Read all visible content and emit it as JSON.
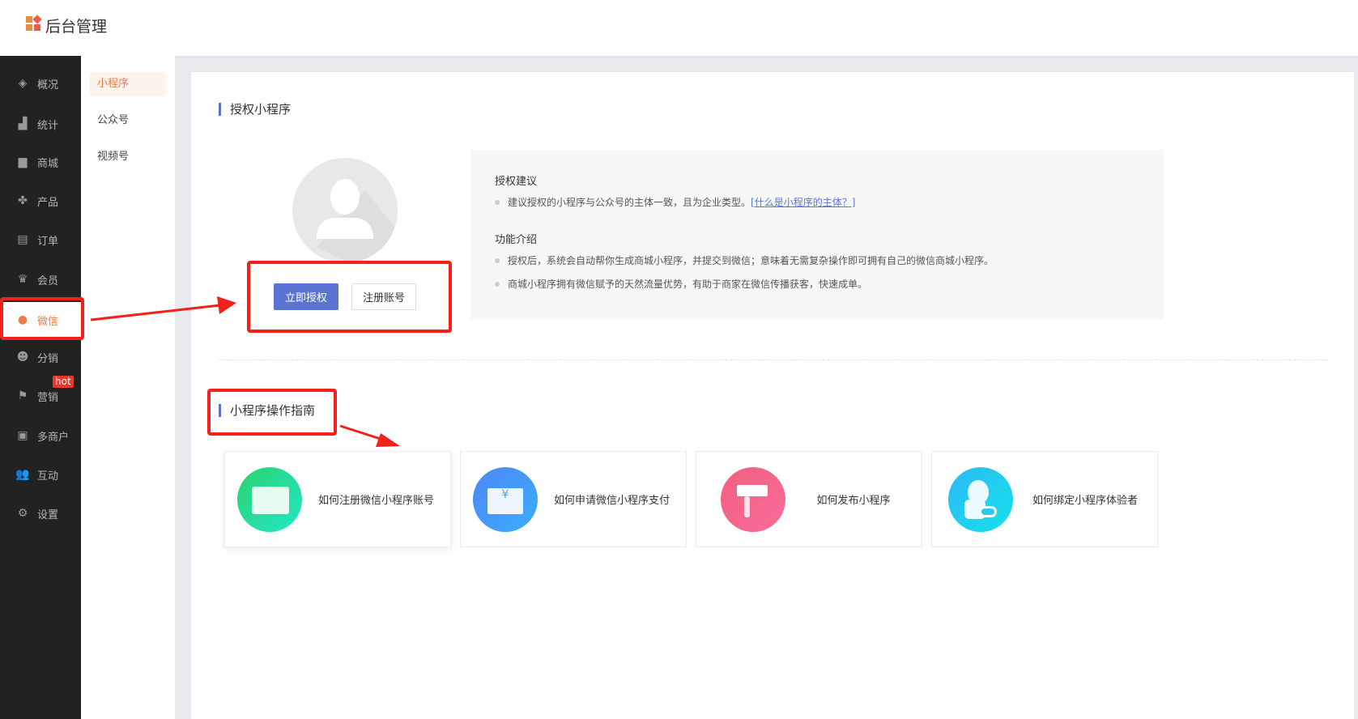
{
  "header": {
    "title": "后台管理"
  },
  "sidebar": {
    "items": [
      {
        "label": "概况",
        "icon": "layers-icon"
      },
      {
        "label": "统计",
        "icon": "chart-icon"
      },
      {
        "label": "商城",
        "icon": "store-icon"
      },
      {
        "label": "产品",
        "icon": "grid-icon"
      },
      {
        "label": "订单",
        "icon": "clipboard-icon"
      },
      {
        "label": "会员",
        "icon": "crown-icon"
      },
      {
        "label": "微信",
        "icon": "wechat-icon",
        "active": true
      },
      {
        "label": "分销",
        "icon": "users-icon"
      },
      {
        "label": "营销",
        "icon": "flag-icon",
        "badge": "hot"
      },
      {
        "label": "多商户",
        "icon": "merchant-icon"
      },
      {
        "label": "互动",
        "icon": "people-icon"
      },
      {
        "label": "设置",
        "icon": "gear-icon"
      }
    ]
  },
  "submenu": {
    "items": [
      {
        "label": "小程序",
        "active": true
      },
      {
        "label": "公众号"
      },
      {
        "label": "视频号"
      }
    ]
  },
  "auth": {
    "title": "授权小程序",
    "authorize_button": "立即授权",
    "register_button": "注册账号"
  },
  "info": {
    "suggest_title": "授权建议",
    "suggest_text": "建议授权的小程序与公众号的主体一致，且为企业类型。",
    "suggest_link": "[什么是小程序的主体？]",
    "feature_title": "功能介绍",
    "features": [
      "授权后，系统会自动帮你生成商城小程序，并提交到微信；意味着无需复杂操作即可拥有自己的微信商城小程序。",
      "商城小程序拥有微信赋予的天然流量优势，有助于商家在微信传播获客，快速成单。"
    ]
  },
  "guide": {
    "title": "小程序操作指南",
    "cards": [
      {
        "label": "如何注册微信小程序账号",
        "color": "#2ed47a"
      },
      {
        "label": "如何申请微信小程序支付",
        "color": "#3f8ff5"
      },
      {
        "label": "如何发布小程序",
        "color": "#f0607e"
      },
      {
        "label": "如何绑定小程序体验者",
        "color": "#1fc9ea"
      }
    ]
  },
  "colors": {
    "accent": "#f07b45",
    "primary": "#5a74d4",
    "annotation": "#f5201a"
  }
}
